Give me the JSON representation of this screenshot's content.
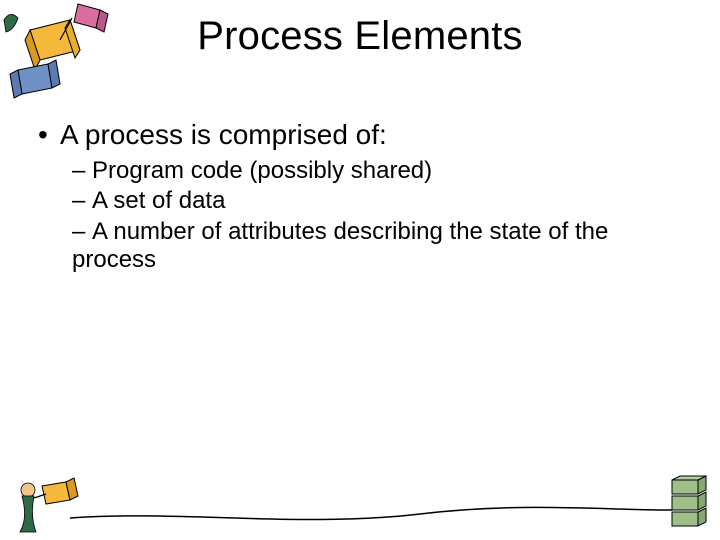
{
  "title": "Process Elements",
  "bullets": {
    "lvl1": "A process is comprised of:",
    "lvl2": [
      "Program code (possibly shared)",
      "A set of data",
      "A number of attributes describing the state of the process"
    ]
  }
}
